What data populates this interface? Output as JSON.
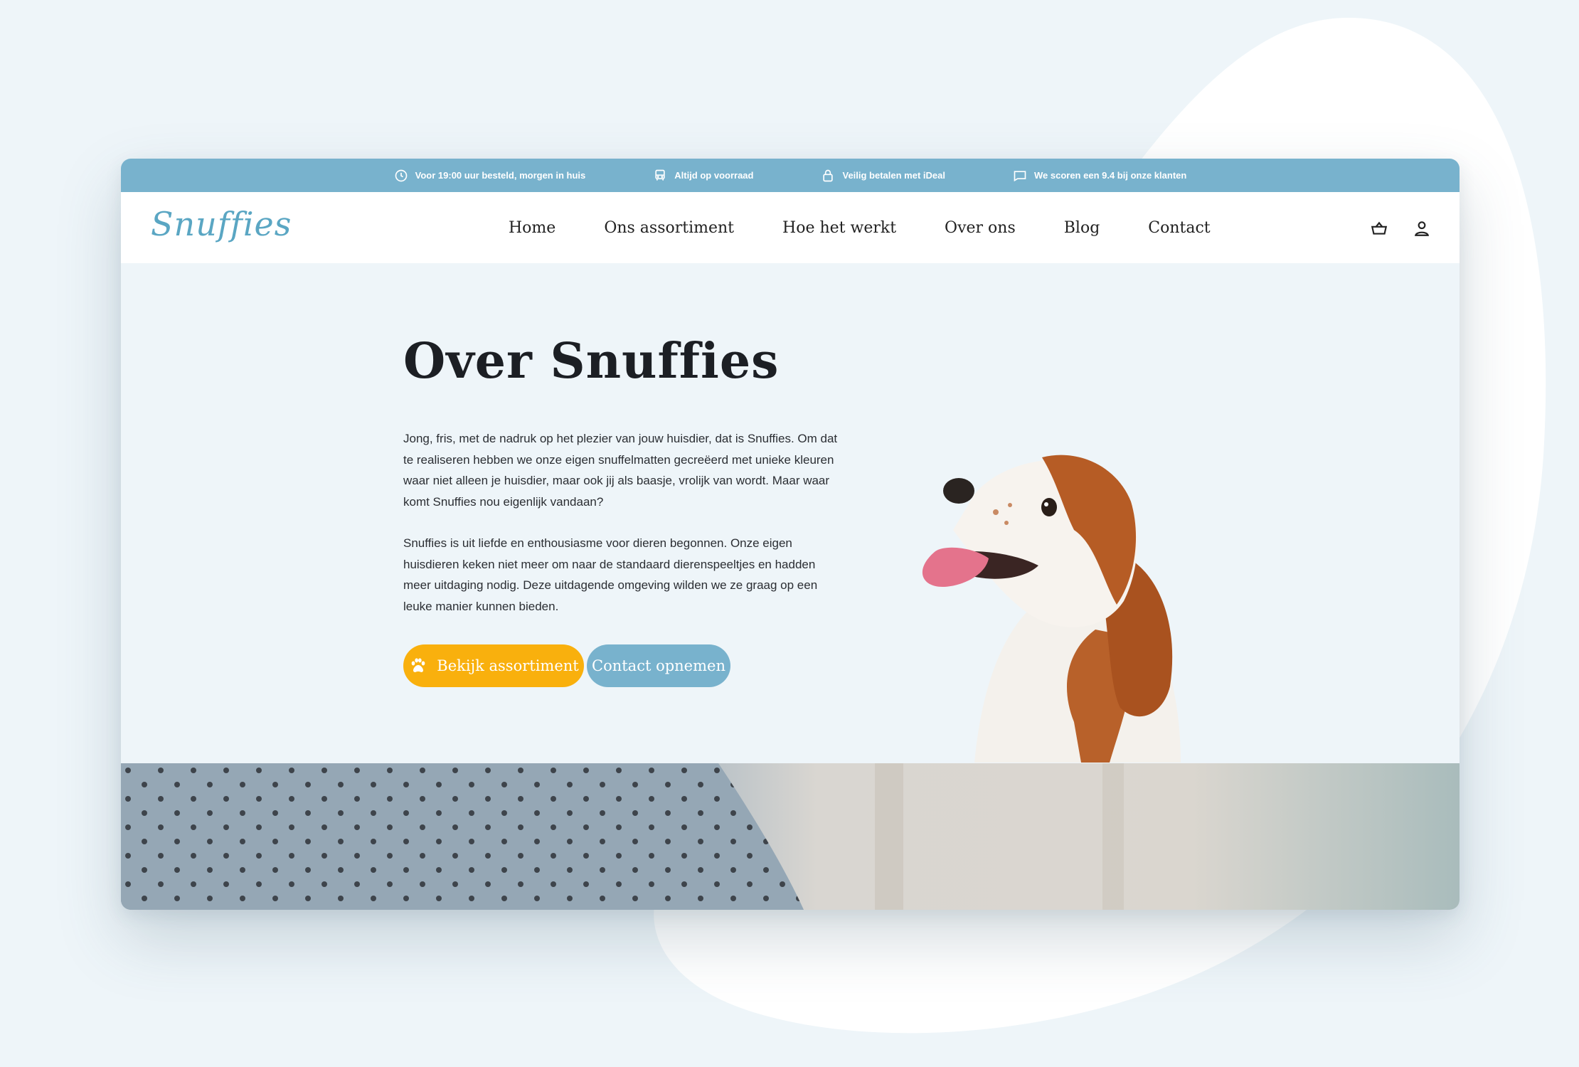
{
  "colors": {
    "topbar": "#78b2cd",
    "accent_orange": "#f9b00d",
    "logo_blue": "#5aa6c3",
    "page_bg": "#eef5f9"
  },
  "topbar": {
    "usps": [
      {
        "icon": "clock-icon",
        "text": "Voor 19:00 uur besteld, morgen in huis"
      },
      {
        "icon": "truck-icon",
        "text": "Altijd op voorraad"
      },
      {
        "icon": "lock-icon",
        "text": "Veilig betalen met iDeal"
      },
      {
        "icon": "chat-icon",
        "text": "We scoren een 9.4 bij onze klanten"
      }
    ]
  },
  "header": {
    "logo": "Snuffies",
    "menu": [
      "Home",
      "Ons assortiment",
      "Hoe het werkt",
      "Over ons",
      "Blog",
      "Contact"
    ],
    "icons": [
      "basket-icon",
      "user-icon"
    ]
  },
  "hero": {
    "title": "Over Snuffies",
    "paragraph1": "Jong, fris, met de nadruk op het plezier van jouw huisdier, dat is Snuffies. Om dat te realiseren hebben we onze eigen snuffelmatten gecreëerd met unieke kleuren waar niet alleen je huisdier, maar ook jij als baasje, vrolijk van wordt. Maar waar komt Snuffies nou eigenlijk vandaan?",
    "paragraph2": "Snuffies is uit liefde en enthousiasme voor dieren begonnen. Onze eigen huisdieren keken niet meer om naar de standaard dierenspeeltjes en hadden meer uitdaging nodig. Deze uitdagende omgeving wilden we ze graag op een leuke manier kunnen bieden.",
    "primary_button": "Bekijk assortiment",
    "secondary_button": "Contact opnemen"
  }
}
